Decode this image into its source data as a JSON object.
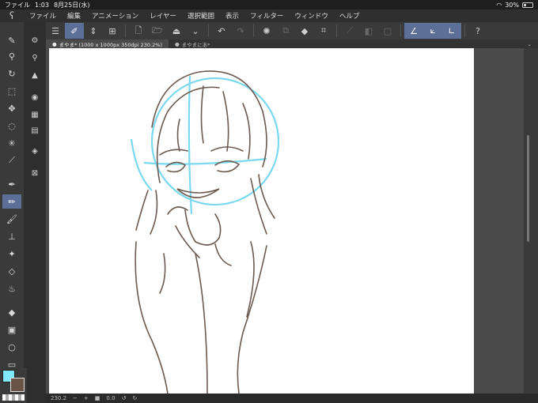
{
  "status_bar": {
    "app_label": "ファイル",
    "time": "1:03",
    "date": "8月25日(水)",
    "battery": "30%"
  },
  "menu": {
    "items": [
      "ファイル",
      "編集",
      "アニメーション",
      "レイヤー",
      "選択範囲",
      "表示",
      "フィルター",
      "ウィンドウ",
      "ヘルプ"
    ]
  },
  "tabs": [
    {
      "label": "まやま* (1000 x 1000px 350dpi 230.2%)",
      "active": true
    },
    {
      "label": "まやまにあ*",
      "active": false
    }
  ],
  "bottom": {
    "zoom": "230.2",
    "angle": "0.0"
  },
  "colors": {
    "main": "#7fe8ff",
    "sub": "#6a5448",
    "accent": "#5b6f97"
  },
  "icons": {
    "toolbar": [
      "pen-icon",
      "zoom-icon",
      "rotate-icon",
      "object-select-icon",
      "move-icon",
      "lasso-icon",
      "magic-wand-icon",
      "eyedropper-icon",
      "g-pen-icon",
      "pencil-icon",
      "brush-icon",
      "airbrush-icon",
      "decoration-icon",
      "eraser-icon",
      "blend-icon",
      "fill-icon",
      "gradient-icon",
      "figure-icon",
      "frame-icon"
    ],
    "subtool": [
      "layer-property-icon",
      "layer-search-icon",
      "sub-view-icon",
      "navigator-icon",
      "material-icon",
      "color-set-icon",
      "layers-icon",
      "close-palette-icon"
    ]
  }
}
